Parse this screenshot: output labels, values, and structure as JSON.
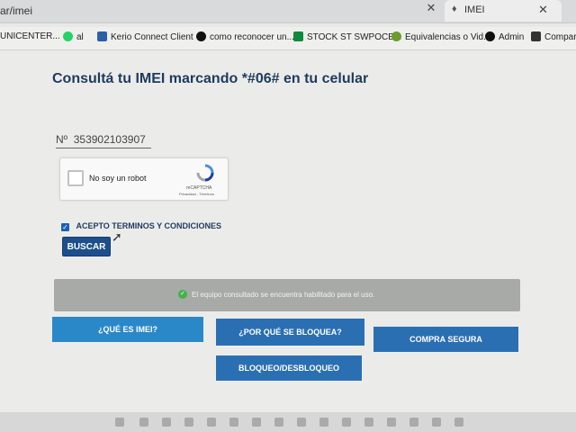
{
  "browser": {
    "url_fragment": "ar/imei",
    "active_tab_title": "IMEI",
    "bookmarks": [
      {
        "label": "UNICENTER...",
        "icon": "folder-icon",
        "color": "#e0a93b"
      },
      {
        "label": "al",
        "icon": "whatsapp-icon",
        "color": "#25d366"
      },
      {
        "label": "Kerio Connect Client",
        "icon": "kerio-icon",
        "color": "#2d5fa7"
      },
      {
        "label": "como reconocer un...",
        "icon": "apple-icon",
        "color": "#111111"
      },
      {
        "label": "STOCK ST SWPOCE...",
        "icon": "sheets-icon",
        "color": "#0f8a3d"
      },
      {
        "label": "Equivalencias o Vid...",
        "icon": "web-icon",
        "color": "#6d9b2d"
      },
      {
        "label": "Admin",
        "icon": "github-icon",
        "color": "#111111"
      },
      {
        "label": "Compare",
        "icon": "bookmark-icon",
        "color": "#333333"
      }
    ]
  },
  "page": {
    "title": "Consultá tu IMEI marcando *#06# en tu celular",
    "imei_value": "Nº  353902103907",
    "recaptcha": {
      "label": "No soy un robot",
      "brand": "reCAPTCHA",
      "links": "Privacidad - Términos"
    },
    "terms_label": "ACEPTO TERMINOS Y CONDICIONES",
    "search_button": "BUSCAR",
    "status_message": "El equipo consultado se encuentra habilitado para el uso.",
    "buttons": {
      "what_is_imei": "¿QUÉ ES IMEI?",
      "why_blocked": "¿POR QUÉ SE BLOQUEA?",
      "safe_purchase": "COMPRA SEGURA",
      "block_unblock": "BLOQUEO/DESBLOQUEO"
    }
  },
  "colors": {
    "title": "#1f3a5f",
    "primary_button": "#2b6fb3",
    "status_ok": "#3fb44a"
  }
}
